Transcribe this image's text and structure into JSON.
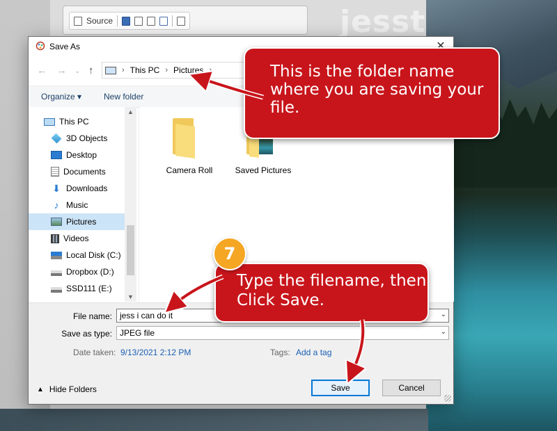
{
  "background": {
    "toolbar_source_label": "Source",
    "watermark": "jesstu",
    "accent_red": "#c8151b",
    "badge_orange": "#f5a623"
  },
  "dialog": {
    "title": "Save As",
    "close_glyph": "✕",
    "address": {
      "crumbs": [
        "This PC",
        "Pictures"
      ]
    },
    "commands": {
      "organize": "Organize ▾",
      "new_folder": "New folder"
    },
    "nav_items": [
      {
        "label": "This PC",
        "icon": "computer-icon"
      },
      {
        "label": "3D Objects",
        "icon": "cube-icon"
      },
      {
        "label": "Desktop",
        "icon": "desktop-icon"
      },
      {
        "label": "Documents",
        "icon": "document-icon"
      },
      {
        "label": "Downloads",
        "icon": "download-arrow-icon"
      },
      {
        "label": "Music",
        "icon": "music-note-icon"
      },
      {
        "label": "Pictures",
        "icon": "pictures-icon",
        "selected": true
      },
      {
        "label": "Videos",
        "icon": "film-icon"
      },
      {
        "label": "Local Disk (C:)",
        "icon": "windows-drive-icon"
      },
      {
        "label": "Dropbox (D:)",
        "icon": "drive-icon"
      },
      {
        "label": "SSD111 (E:)",
        "icon": "drive-icon"
      }
    ],
    "folders": [
      {
        "name": "Camera Roll",
        "icon": "folder-icon"
      },
      {
        "name": "Saved Pictures",
        "icon": "folder-with-photo-icon"
      }
    ],
    "filename_label": "File name:",
    "filename_value": "jess i can do it",
    "savetype_label": "Save as type:",
    "savetype_value": "JPEG file",
    "date_label": "Date taken:",
    "date_value": "9/13/2021 2:12 PM",
    "tags_label": "Tags:",
    "tags_value": "Add a tag",
    "hide_folders": "Hide Folders",
    "save_button": "Save",
    "cancel_button": "Cancel"
  },
  "callouts": {
    "folder_note": "This is the folder name where you are saving your file.",
    "step_number": "7",
    "step_note": "Type the filename, then Click Save."
  }
}
